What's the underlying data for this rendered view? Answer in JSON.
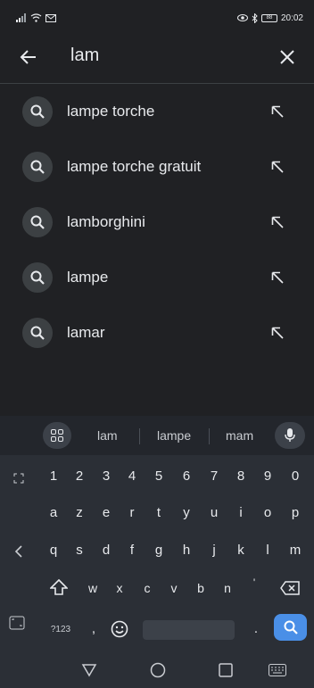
{
  "status_bar": {
    "time": "20:02",
    "battery": "88"
  },
  "search": {
    "query": "lam"
  },
  "suggestions": [
    {
      "label": "lampe torche"
    },
    {
      "label": "lampe torche gratuit"
    },
    {
      "label": "lamborghini"
    },
    {
      "label": "lampe"
    },
    {
      "label": "lamar"
    }
  ],
  "keyboard": {
    "suggestions": [
      "lam",
      "lampe",
      "mam"
    ],
    "row_numbers": [
      "1",
      "2",
      "3",
      "4",
      "5",
      "6",
      "7",
      "8",
      "9",
      "0"
    ],
    "row1": [
      "a",
      "z",
      "e",
      "r",
      "t",
      "y",
      "u",
      "i",
      "o",
      "p"
    ],
    "row2": [
      "q",
      "s",
      "d",
      "f",
      "g",
      "h",
      "j",
      "k",
      "l",
      "m"
    ],
    "row3": [
      "w",
      "x",
      "c",
      "v",
      "b",
      "n",
      "'"
    ],
    "symbols_key": "?123",
    "comma": ",",
    "period": "."
  },
  "colors": {
    "background": "#202124",
    "keyboard": "#2b2f36",
    "search_key": "#4a8fe7"
  }
}
